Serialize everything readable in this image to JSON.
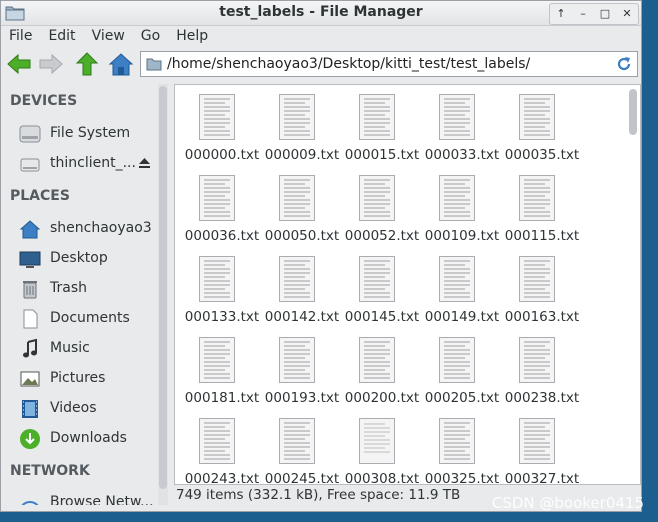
{
  "window": {
    "title": "test_labels - File Manager",
    "buttons": [
      "↑",
      "–",
      "□",
      "✕"
    ]
  },
  "menu": [
    "File",
    "Edit",
    "View",
    "Go",
    "Help"
  ],
  "toolbar": {
    "location": "/home/shenchaoyao3/Desktop/kitti_test/test_labels/"
  },
  "sidebar": {
    "devices_header": "DEVICES",
    "devices": [
      {
        "label": "File System",
        "icon": "drive-icon"
      },
      {
        "label": "thinclient_...",
        "icon": "removable-drive-icon"
      }
    ],
    "places_header": "PLACES",
    "places": [
      {
        "label": "shenchaoyao3",
        "icon": "home-icon"
      },
      {
        "label": "Desktop",
        "icon": "desktop-icon"
      },
      {
        "label": "Trash",
        "icon": "trash-icon"
      },
      {
        "label": "Documents",
        "icon": "documents-icon"
      },
      {
        "label": "Music",
        "icon": "music-icon"
      },
      {
        "label": "Pictures",
        "icon": "pictures-icon"
      },
      {
        "label": "Videos",
        "icon": "videos-icon"
      },
      {
        "label": "Downloads",
        "icon": "downloads-icon"
      }
    ],
    "network_header": "NETWORK",
    "network": [
      {
        "label": "Browse Netw...",
        "icon": "network-icon"
      }
    ]
  },
  "files": [
    "000000.txt",
    "000009.txt",
    "000015.txt",
    "000033.txt",
    "000035.txt",
    "000036.txt",
    "000050.txt",
    "000052.txt",
    "000109.txt",
    "000115.txt",
    "000133.txt",
    "000142.txt",
    "000145.txt",
    "000149.txt",
    "000163.txt",
    "000181.txt",
    "000193.txt",
    "000200.txt",
    "000205.txt",
    "000238.txt",
    "000243.txt",
    "000245.txt",
    "000308.txt",
    "000325.txt",
    "000327.txt"
  ],
  "status": "749 items (332.1 kB), Free space: 11.9 TB",
  "watermark": "CSDN @booker0415",
  "colors": {
    "accent_blue": "#3d7fc4",
    "nav_green": "#4caf2a",
    "sidebar_bg": "#e8eaec",
    "desktop_bg": "#1c5f8f"
  }
}
